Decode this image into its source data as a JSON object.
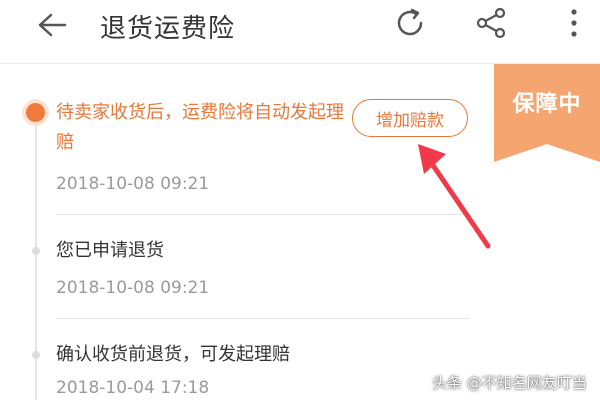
{
  "header": {
    "title": "退货运费险",
    "back_icon": "arrow-left-icon",
    "refresh_icon": "refresh-icon",
    "share_icon": "share-icon",
    "more_icon": "more-vertical-icon"
  },
  "ribbon": {
    "label": "保障中",
    "color": "#f5a56f"
  },
  "timeline": [
    {
      "text": "待卖家收货后，运费险将自动发起理赔",
      "time": "2018-10-08 09:21",
      "active": true
    },
    {
      "text": "您已申请退货",
      "time": "2018-10-08 09:21",
      "active": false
    },
    {
      "text": "确认收货前退货，可发起理赔",
      "time": "2018-10-04 17:18",
      "active": false
    }
  ],
  "add_button": {
    "label": "增加赔款"
  },
  "annotation": {
    "arrow_color": "#f03a4a"
  },
  "watermark": "头条 @不知名网友叮当",
  "colors": {
    "accent": "#e8773a",
    "text": "#333333",
    "muted": "#9a9a9a"
  }
}
